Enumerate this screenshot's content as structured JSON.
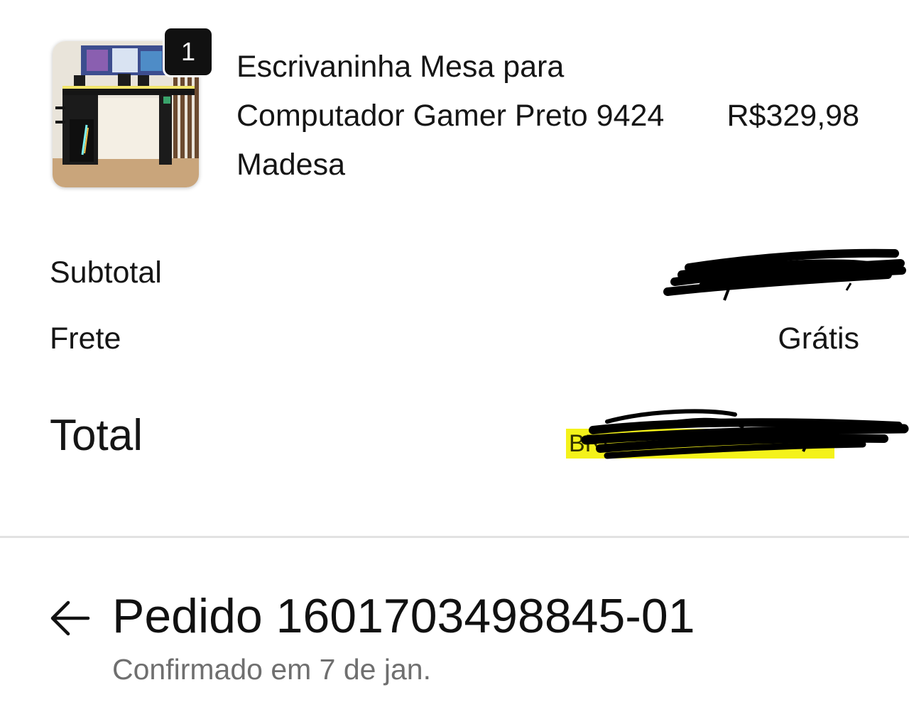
{
  "product": {
    "quantity": "1",
    "name": "Escrivaninha Mesa para Computador Gamer Preto 9424 Madesa",
    "price": "R$329,98",
    "image_icon": "gamer-desk-photo"
  },
  "summary": {
    "subtotal_label": "Subtotal",
    "subtotal_value": "",
    "shipping_label": "Frete",
    "shipping_value": "Grátis",
    "total_label": "Total",
    "total_value_visible": "BRL",
    "redaction_color": "#000000",
    "highlight_color": "#f4f21a"
  },
  "order": {
    "back_icon": "arrow-left-icon",
    "title": "Pedido 1601703498845-01",
    "status": "Confirmado em 7 de jan."
  }
}
